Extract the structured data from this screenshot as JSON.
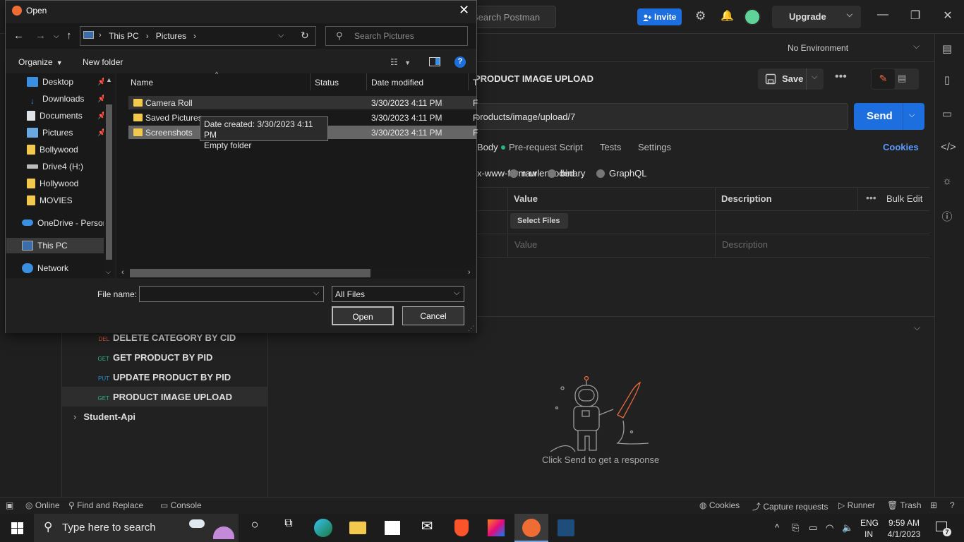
{
  "postman": {
    "search_placeholder": "Search Postman",
    "invite_label": "Invite",
    "upgrade_label": "Upgrade",
    "environment": "No Environment",
    "request_title": "PRODUCT IMAGE UPLOAD",
    "save_label": "Save",
    "url_text": "products/image/upload/7",
    "send_label": "Send",
    "tabs": [
      "Body",
      "Pre-request Script",
      "Tests",
      "Settings"
    ],
    "cookies_link": "Cookies",
    "body_types": [
      "x-www-form-urlencoded",
      "raw",
      "binary",
      "GraphQL"
    ],
    "table": {
      "value_header": "Value",
      "description_header": "Description",
      "bulk_edit": "Bulk Edit",
      "select_files": "Select Files",
      "value_placeholder": "Value",
      "description_placeholder": "Description"
    },
    "response_message": "Click Send to get a response",
    "sidebar": {
      "items": [
        {
          "method": "DEL",
          "name": "DELETE CATEGORY BY CID"
        },
        {
          "method": "GET",
          "name": "GET PRODUCT BY PID"
        },
        {
          "method": "PUT",
          "name": "UPDATE PRODUCT BY PID"
        },
        {
          "method": "GET",
          "name": "PRODUCT IMAGE UPLOAD"
        }
      ],
      "collection": "Student-Api"
    },
    "status_bar": {
      "online": "Online",
      "find_replace": "Find and Replace",
      "console": "Console",
      "cookies": "Cookies",
      "capture": "Capture requests",
      "runner": "Runner",
      "trash": "Trash"
    }
  },
  "dialog": {
    "title": "Open",
    "breadcrumb": [
      "This PC",
      "Pictures"
    ],
    "search_placeholder": "Search Pictures",
    "organize": "Organize",
    "new_folder": "New folder",
    "nav_pane": [
      {
        "label": "Desktop",
        "icon": "desktop-icon",
        "pinned": true
      },
      {
        "label": "Downloads",
        "icon": "download-icon",
        "pinned": true
      },
      {
        "label": "Documents",
        "icon": "document-icon",
        "pinned": true
      },
      {
        "label": "Pictures",
        "icon": "pictures-icon",
        "pinned": true
      },
      {
        "label": "Bollywood",
        "icon": "folder-icon",
        "pinned": false
      },
      {
        "label": "Drive4 (H:)",
        "icon": "drive-icon",
        "pinned": false
      },
      {
        "label": "Hollywood",
        "icon": "folder-icon",
        "pinned": false
      },
      {
        "label": "MOVIES",
        "icon": "folder-icon",
        "pinned": false
      },
      {
        "label": "OneDrive - Persor",
        "icon": "onedrive-icon",
        "pinned": false
      },
      {
        "label": "This PC",
        "icon": "pc-icon",
        "pinned": false
      },
      {
        "label": "Network",
        "icon": "network-icon",
        "pinned": false
      }
    ],
    "columns": [
      "Name",
      "Status",
      "Date modified",
      "T"
    ],
    "files": [
      {
        "name": "Camera Roll",
        "date": "3/30/2023 4:11 PM",
        "type": "F"
      },
      {
        "name": "Saved Pictures",
        "date": "3/30/2023 4:11 PM",
        "type": "F"
      },
      {
        "name": "Screenshots",
        "date": "3/30/2023 4:11 PM",
        "type": "F"
      }
    ],
    "tooltip": [
      "Date created: 3/30/2023 4:11 PM",
      "Empty folder"
    ],
    "file_name_label": "File name:",
    "file_name_value": "",
    "file_type": "All Files",
    "open_label": "Open",
    "cancel_label": "Cancel"
  },
  "taskbar": {
    "search_placeholder": "Type here to search",
    "language": "ENG",
    "region": "IN",
    "time": "9:59 AM",
    "date": "4/1/2023",
    "notifications": "7"
  }
}
